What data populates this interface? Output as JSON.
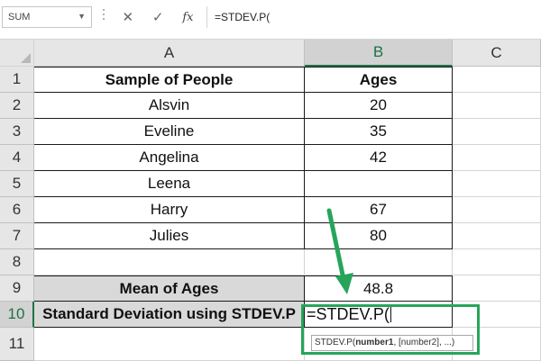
{
  "formula_bar": {
    "name_box": "SUM",
    "name_box_dropdown_icon": "chevron-down-icon",
    "cancel_symbol": "✕",
    "enter_symbol": "✓",
    "fx_label": "fx",
    "formula": "=STDEV.P("
  },
  "columns": [
    "A",
    "B",
    "C"
  ],
  "rows": [
    "1",
    "2",
    "3",
    "4",
    "5",
    "6",
    "7",
    "8",
    "9",
    "10",
    "11"
  ],
  "table": {
    "header": {
      "col_a": "Sample of People",
      "col_b": "Ages"
    },
    "people": [
      {
        "name": "Alsvin",
        "age": "20"
      },
      {
        "name": "Eveline",
        "age": "35"
      },
      {
        "name": "Angelina",
        "age": "42"
      },
      {
        "name": "Leena",
        "age": ""
      },
      {
        "name": "Harry",
        "age": "67"
      },
      {
        "name": "Julies",
        "age": "80"
      }
    ],
    "mean_label": "Mean of Ages",
    "mean_value": "48.8",
    "stdev_label": "Standard Deviation using STDEV.P",
    "stdev_formula": "=STDEV.P("
  },
  "tooltip": {
    "fn": "STDEV.P(",
    "arg1": "number1",
    "rest": ", [number2], ...)"
  },
  "colors": {
    "annotation_green": "#26a55a",
    "excel_green": "#217346"
  }
}
